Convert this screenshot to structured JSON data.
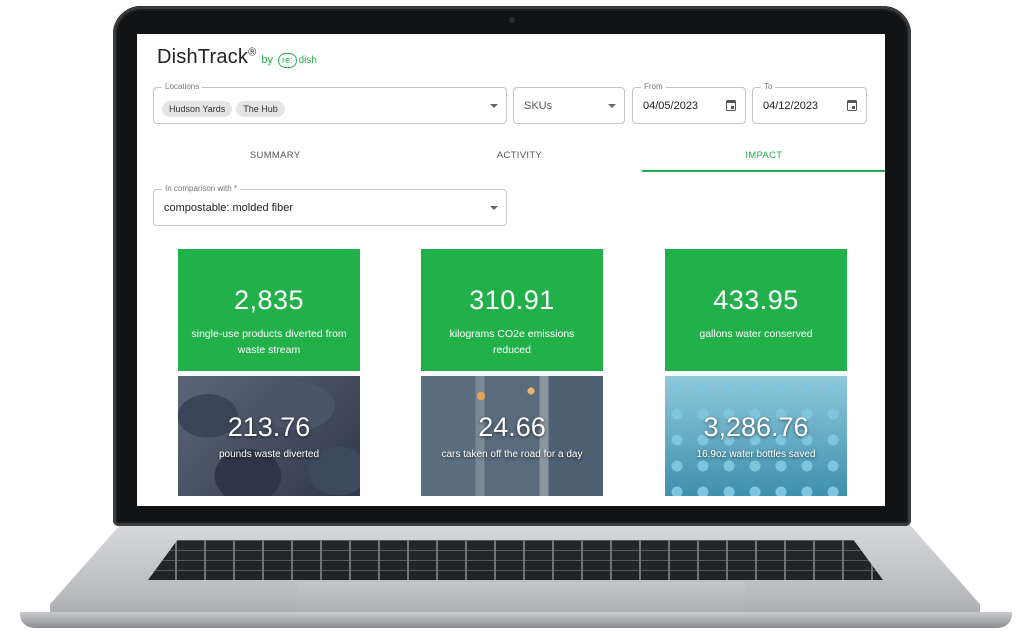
{
  "brand": {
    "name": "DishTrack",
    "registered": "®",
    "by": "by",
    "logo_re": "re:",
    "logo_dish": "dish"
  },
  "filters": {
    "locations_label": "Locations",
    "locations": [
      "Hudson Yards",
      "The Hub"
    ],
    "skus_placeholder": "SKUs",
    "from_label": "From",
    "from_value": "04/05/2023",
    "to_label": "To",
    "to_value": "04/12/2023"
  },
  "tabs": [
    {
      "label": "SUMMARY",
      "active": false
    },
    {
      "label": "ACTIVITY",
      "active": false
    },
    {
      "label": "IMPACT",
      "active": true
    }
  ],
  "comparison": {
    "label": "In comparison with *",
    "value": "compostable: molded fiber"
  },
  "colors": {
    "accent": "#22b04b"
  },
  "stats": [
    {
      "value": "2,835",
      "label": "single-use products diverted from waste stream"
    },
    {
      "value": "310.91",
      "label": "kilograms CO2e emissions reduced"
    },
    {
      "value": "433.95",
      "label": "gallons water conserved"
    }
  ],
  "equivalents": [
    {
      "value": "213.76",
      "label": "pounds waste diverted",
      "image": "trash-bags"
    },
    {
      "value": "24.66",
      "label": "cars taken off the road for a day",
      "image": "traffic"
    },
    {
      "value": "3,286.76",
      "label": "16.9oz water bottles saved",
      "image": "water-bottles"
    }
  ]
}
